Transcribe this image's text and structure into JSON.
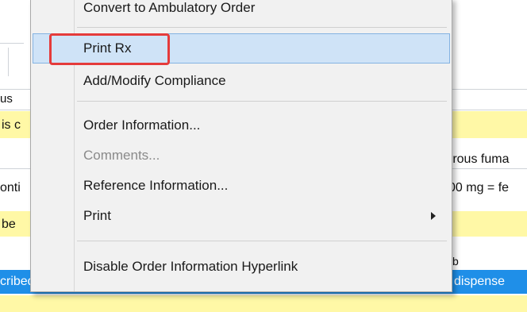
{
  "background": {
    "snippets": {
      "s_fragment": "s",
      "header_us": "us",
      "is_fragment": "is c",
      "iron_fragment": "rrous fuma",
      "onti_fragment": "onti",
      "dose_fragment": "00 mg = fe",
      "be_fragment": " be",
      "b_fragment": "b",
      "cribed": "cribed",
      "dispense_fragment": "dispense"
    },
    "colors": {
      "highlight_yellow": "#fff8a6",
      "selection_blue": "#1f8fe8"
    }
  },
  "context_menu": {
    "top_item": "Convert to Ambulatory Order",
    "items": [
      {
        "label": "Print Rx",
        "highlighted": true
      },
      {
        "label": "Add/Modify Compliance"
      },
      {
        "label": "Order Information..."
      },
      {
        "label": "Comments...",
        "disabled": true
      },
      {
        "label": "Reference Information..."
      },
      {
        "label": "Print",
        "submenu": true
      },
      {
        "label": "Disable Order Information Hyperlink"
      }
    ],
    "callout_color": "#e53b3b"
  }
}
